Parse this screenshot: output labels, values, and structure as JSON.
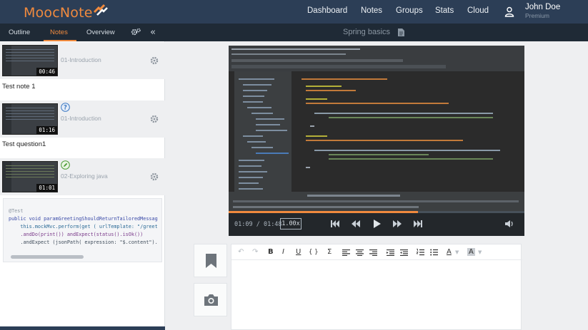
{
  "app": {
    "name": "MoocNote"
  },
  "nav": {
    "items": [
      "Dashboard",
      "Notes",
      "Groups",
      "Stats",
      "Cloud"
    ]
  },
  "user": {
    "name": "John Doe",
    "role": "Premium"
  },
  "subnav": {
    "tabs": [
      "Outline",
      "Notes",
      "Overview"
    ],
    "active": "Notes"
  },
  "lesson": {
    "title": "Spring basics"
  },
  "notes": [
    {
      "timestamp": "00:46",
      "chapter": "01-Introduction",
      "text": "Test note 1",
      "badge": ""
    },
    {
      "timestamp": "01:16",
      "chapter": "01-Introduction",
      "text": "Test question1",
      "badge": "question-icon"
    },
    {
      "timestamp": "01:01",
      "chapter": "02-Exploring java",
      "text": "",
      "badge": "edit-icon"
    }
  ],
  "code_snippet": {
    "lines": [
      "@Test",
      "public void paramGreetingShouldReturnTailoredMessag",
      "    this.mockMvc.perform(get ( urlTemplate: \"/greet",
      "    .andDo(print()) andExpect(status().isOk())",
      "    .andExpect (jsonPath( expression: \"$.content\")."
    ]
  },
  "player": {
    "current": "01:09",
    "duration": "01:48",
    "time_sep": " / ",
    "speed": "1.00x"
  },
  "editor_toolbar": {
    "bold": "B",
    "italic": "I",
    "underline": "U",
    "code": "{ }",
    "formula": "Σ",
    "font_color": "A",
    "highlight": "A"
  },
  "colors": {
    "brand": "#f08a3e",
    "topbar": "#2c3e56",
    "subbar": "#1f2a36"
  }
}
